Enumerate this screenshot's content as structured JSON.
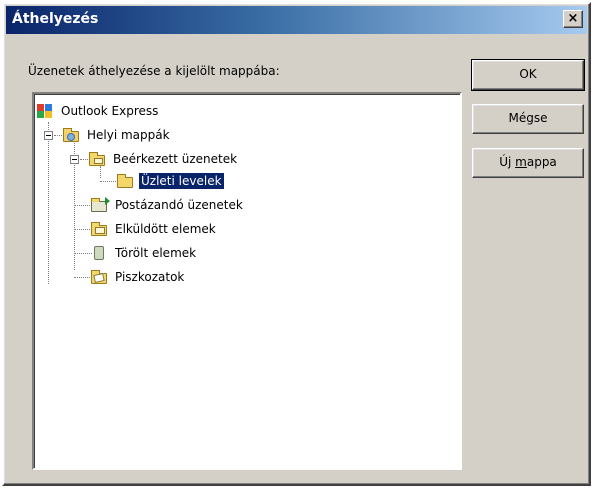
{
  "window": {
    "title": "Áthelyezés",
    "close_glyph": "×",
    "colors": {
      "titlebar_start": "#0a246a",
      "titlebar_end": "#a6caf0",
      "face": "#d4d0c8",
      "selection": "#0a246a"
    }
  },
  "prompt": "Üzenetek áthelyezése a kijelölt mappába:",
  "buttons": {
    "ok": "OK",
    "cancel": "Mégse",
    "new_folder_prefix": "Új ",
    "new_folder_accel": "m",
    "new_folder_rest": "appa"
  },
  "tree": {
    "root": {
      "label": "Outlook Express",
      "icon": "outlook-express-icon"
    },
    "local_folders": {
      "label": "Helyi mappák",
      "icon": "local-folders-icon",
      "expanded": true
    },
    "inbox": {
      "label": "Beérkezett üzenetek",
      "icon": "inbox-icon",
      "expanded": true
    },
    "business": {
      "label": "Üzleti levelek",
      "icon": "folder-icon",
      "selected": true
    },
    "outbox": {
      "label": "Postázandó üzenetek",
      "icon": "outbox-icon"
    },
    "sent": {
      "label": "Elküldött elemek",
      "icon": "sent-items-icon"
    },
    "deleted": {
      "label": "Törölt elemek",
      "icon": "deleted-items-icon"
    },
    "drafts": {
      "label": "Piszkozatok",
      "icon": "drafts-icon"
    }
  }
}
